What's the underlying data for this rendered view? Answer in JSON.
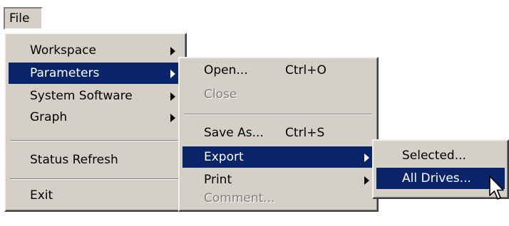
{
  "menubar": {
    "file_label": "File"
  },
  "file_menu": {
    "items": [
      {
        "label": "Workspace"
      },
      {
        "label": "Parameters"
      },
      {
        "label": "System Software"
      },
      {
        "label": "Graph"
      },
      {
        "label": "Status Refresh"
      },
      {
        "label": "Exit"
      }
    ]
  },
  "parameters_menu": {
    "items": [
      {
        "label": "Open...",
        "shortcut": "Ctrl+O"
      },
      {
        "label": "Close"
      },
      {
        "label": "Save As...",
        "shortcut": "Ctrl+S"
      },
      {
        "label": "Export"
      },
      {
        "label": "Print"
      },
      {
        "label": "Comment..."
      }
    ]
  },
  "export_menu": {
    "items": [
      {
        "label": "Selected..."
      },
      {
        "label": "All Drives..."
      }
    ]
  },
  "colors": {
    "menu_bg": "#d4d0c8",
    "highlight": "#0a246a",
    "disabled": "#808080"
  }
}
